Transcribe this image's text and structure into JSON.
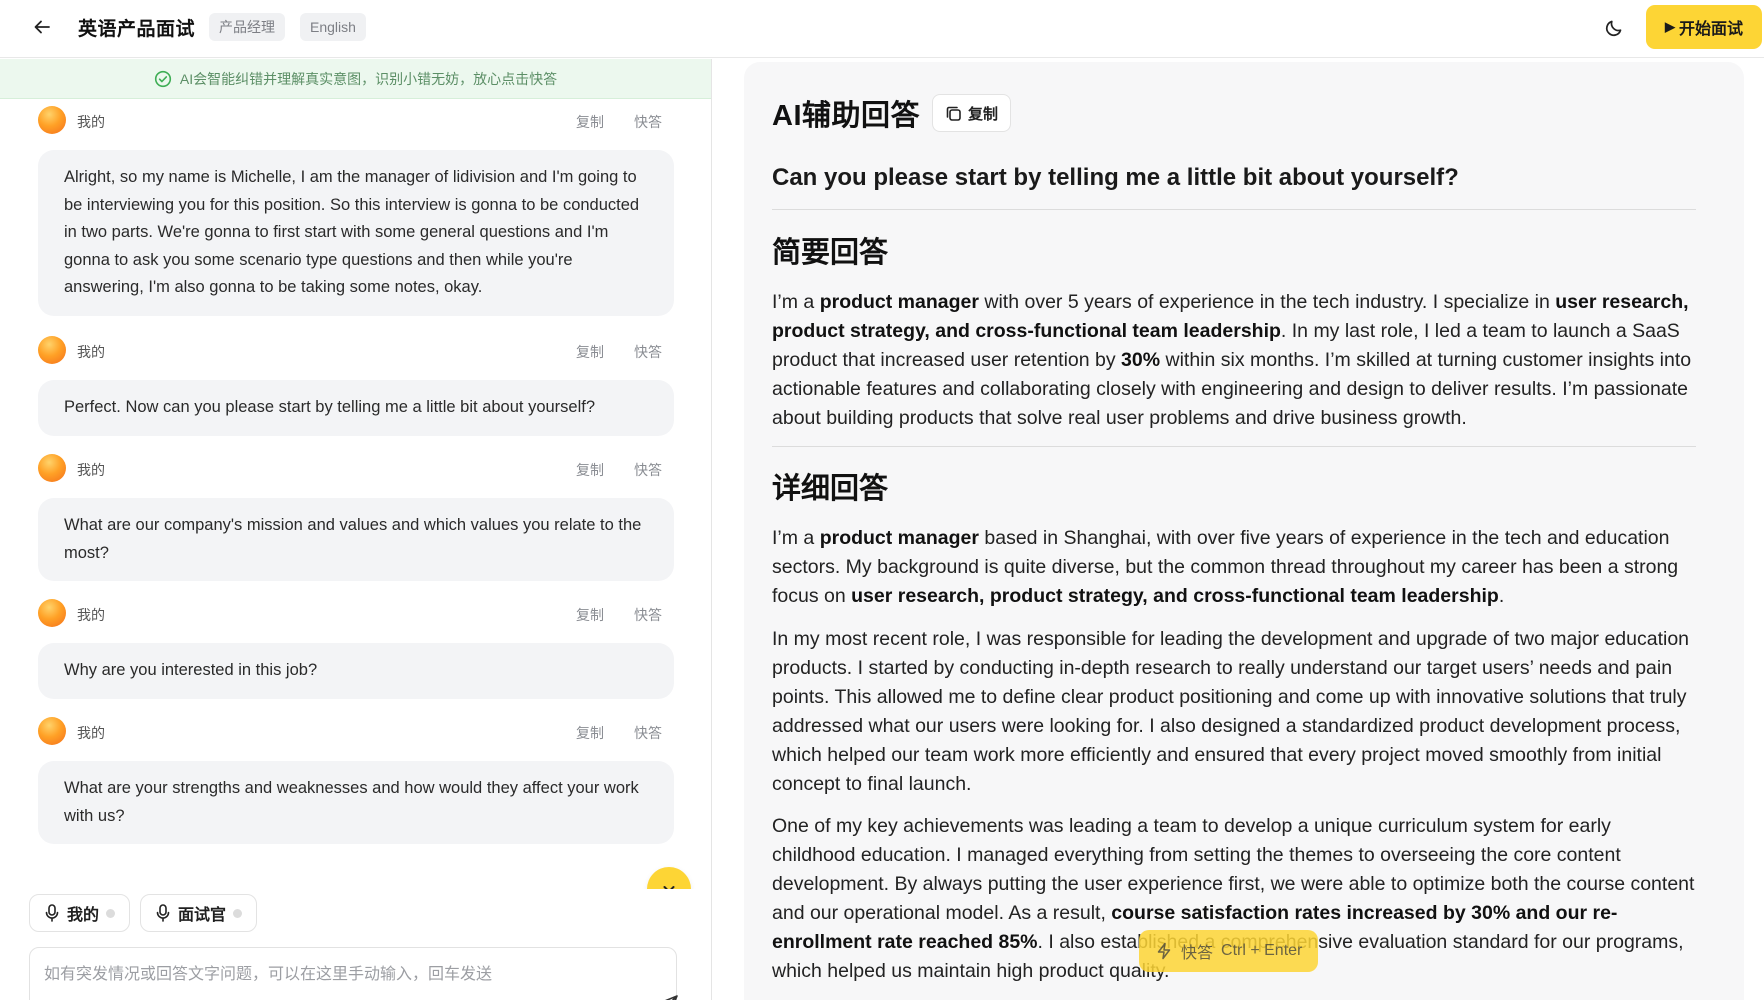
{
  "header": {
    "title": "英语产品面试",
    "role_tag": "产品经理",
    "language_tag": "English",
    "start_label": "开始面试",
    "icons": {
      "back": "arrow-left-icon",
      "theme": "moon-icon",
      "start": "play-icon"
    }
  },
  "notice": {
    "text": "AI会智能纠错并理解真实意图，识别小错无妨，放心点击快答"
  },
  "messages": [
    {
      "speaker": "我的",
      "copy": "复制",
      "quick": "快答",
      "text": "Alright, so my name is Michelle, I am the manager of lidivision and I'm going to be interviewing you for this position. So this interview is gonna to be conducted in two parts. We're gonna to first start with some general questions and I'm gonna to ask you some scenario type questions and then while you're answering, I'm also gonna to be taking some notes, okay."
    },
    {
      "speaker": "我的",
      "copy": "复制",
      "quick": "快答",
      "text": "Perfect. Now can you please start by telling me a little bit about yourself?"
    },
    {
      "speaker": "我的",
      "copy": "复制",
      "quick": "快答",
      "text": "What are our company's mission and values and which values you relate to the most?"
    },
    {
      "speaker": "我的",
      "copy": "复制",
      "quick": "快答",
      "text": "Why are you interested in this job?"
    },
    {
      "speaker": "我的",
      "copy": "复制",
      "quick": "快答",
      "text": "What are your strengths and weaknesses and how would they affect your work with us?"
    }
  ],
  "mic_buttons": {
    "me": "我的",
    "interviewer": "面试官"
  },
  "input": {
    "placeholder": "如有突发情况或回答文字问题，可以在这里手动输入，回车发送"
  },
  "answer": {
    "title": "AI辅助回答",
    "copy_label": "复制",
    "question": "Can you please start by telling me a little bit about yourself?",
    "brief_title": "简要回答",
    "detail_title": "详细回答",
    "brief": {
      "t1": "I’m a ",
      "b1": "product manager",
      "t2": " with over 5 years of experience in the tech industry. I specialize in ",
      "b2": "user research, product strategy, and cross-functional team leadership",
      "t3": ". In my last role, I led a team to launch a SaaS product that increased user retention by ",
      "b3": "30%",
      "t4": " within six months. I’m skilled at turning customer insights into actionable features and collaborating closely with engineering and design to deliver results. I’m passionate about building products that solve real user problems and drive business growth."
    },
    "detail1": {
      "t1": "I’m a ",
      "b1": "product manager",
      "t2": " based in Shanghai, with over five years of experience in the tech and education sectors. My background is quite diverse, but the common thread throughout my career has been a strong focus on ",
      "b2": "user research, product strategy, and cross-functional team leadership",
      "t3": "."
    },
    "detail2": "In my most recent role, I was responsible for leading the development and upgrade of two major education products. I started by conducting in-depth research to really understand our target users’ needs and pain points. This allowed me to define clear product positioning and come up with innovative solutions that truly addressed what our users were looking for. I also designed a standardized product development process, which helped our team work more efficiently and ensured that every project moved smoothly from initial concept to final launch.",
    "detail3": {
      "t1": "One of my key achievements was leading a team to develop a unique curriculum system for early childhood education. I managed everything from setting the themes to overseeing the core content development. By always putting the user experience first, we were able to optimize both the course content and our operational model. As a result, ",
      "b1": "course satisfaction rates increased by 30% and our re-enrollment rate reached 85%",
      "t2": ". I also established a comprehensive evaluation standard for our programs, which helped us maintain high product quality."
    }
  },
  "quick_float": {
    "label": "快答",
    "shortcut": "Ctrl + Enter"
  }
}
